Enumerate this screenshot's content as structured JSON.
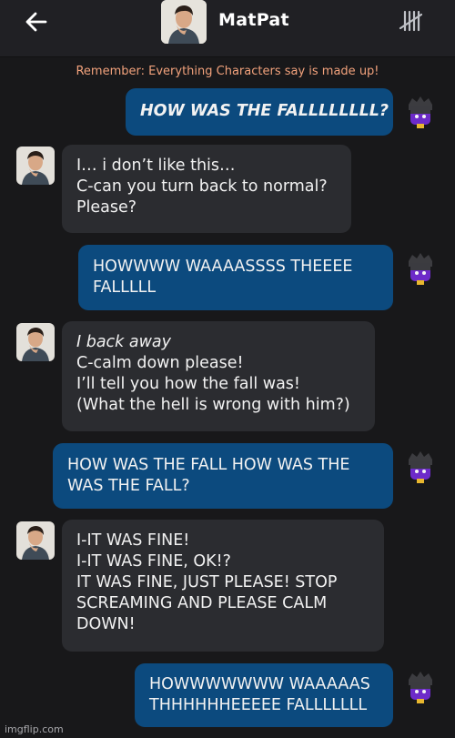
{
  "header": {
    "title": "MatPat"
  },
  "disclaimer": "Remember: Everything Characters say is made up!",
  "messages": [
    {
      "sender": "user",
      "lines": [
        "HOW WAS THE FALLLLLLLL?"
      ]
    },
    {
      "sender": "character",
      "lines": [
        "I… i don’t like this…",
        "C-can you turn back to normal?",
        "Please?"
      ]
    },
    {
      "sender": "user",
      "lines": [
        "HOWWWW WAAAASSSS THEEEE",
        "FALLLLL"
      ]
    },
    {
      "sender": "character",
      "lines": [
        "I back away",
        "C-calm down please!",
        "I’ll tell you how the fall was!",
        "(What the hell is wrong with him?)"
      ]
    },
    {
      "sender": "user",
      "lines": [
        "HOW WAS THE FALL HOW WAS THE",
        "WAS THE FALL?"
      ]
    },
    {
      "sender": "character",
      "lines": [
        "I-IT WAS FINE!",
        "I-IT WAS FINE, OK!?",
        "IT WAS FINE, JUST PLEASE! STOP",
        "SCREAMING AND PLEASE CALM",
        "DOWN!"
      ]
    },
    {
      "sender": "user",
      "lines": [
        "HOWWWWWWW WAAAAAS",
        "THHHHHHEEEEE FALLLLLLL"
      ]
    }
  ],
  "watermark": "imgflip.com",
  "colors": {
    "background": "#18181a",
    "header": "#202024",
    "user_bubble": "#0c4a7e",
    "character_bubble": "#2b2c30",
    "disclaimer": "#f2a27c"
  }
}
